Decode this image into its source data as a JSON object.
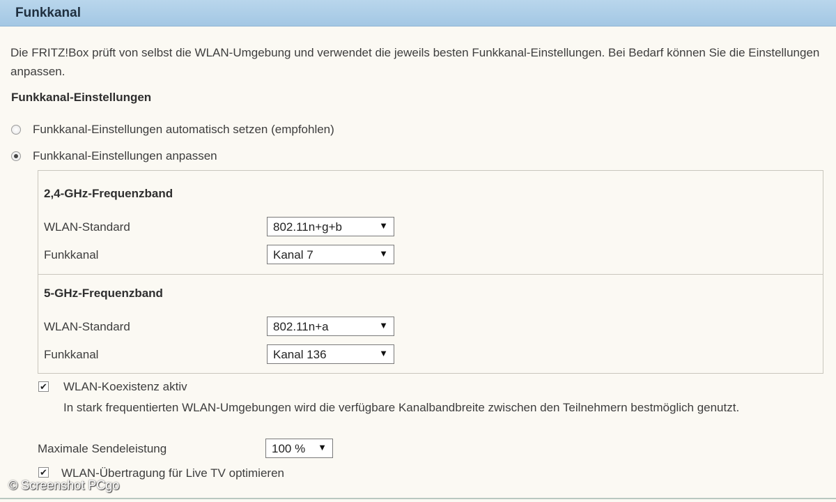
{
  "header": {
    "title": "Funkkanal"
  },
  "intro_text": "Die FRITZ!Box prüft von selbst die WLAN-Umgebung und verwendet die jeweils besten Funkkanal-Einstellungen. Bei Bedarf können Sie die Einstellungen anpassen.",
  "settings_heading": "Funkkanal-Einstellungen",
  "radios": {
    "auto": {
      "label": "Funkkanal-Einstellungen automatisch setzen (empfohlen)",
      "checked": false
    },
    "custom": {
      "label": "Funkkanal-Einstellungen anpassen",
      "checked": true
    }
  },
  "band24": {
    "title": "2,4-GHz-Frequenzband",
    "standard_label": "WLAN-Standard",
    "standard_value": "802.11n+g+b",
    "channel_label": "Funkkanal",
    "channel_value": "Kanal 7"
  },
  "band5": {
    "title": "5-GHz-Frequenzband",
    "standard_label": "WLAN-Standard",
    "standard_value": "802.11n+a",
    "channel_label": "Funkkanal",
    "channel_value": "Kanal 136"
  },
  "coexistence": {
    "label": "WLAN-Koexistenz aktiv",
    "checked": true,
    "hint": "In stark frequentierten WLAN-Umgebungen wird die verfügbare Kanalbandbreite zwischen den Teilnehmern bestmöglich genutzt."
  },
  "power": {
    "label": "Maximale Sendeleistung",
    "value": "100 %"
  },
  "live_tv": {
    "label": "WLAN-Übertragung für Live TV optimieren",
    "checked": true
  },
  "watermark": "© Screenshot PCgo",
  "icons": {
    "dropdown": "dropdown-arrow-icon",
    "check": "checkmark-icon"
  },
  "colors": {
    "header_bg": "#a9cbe6",
    "page_bg": "#fbf9f3"
  }
}
